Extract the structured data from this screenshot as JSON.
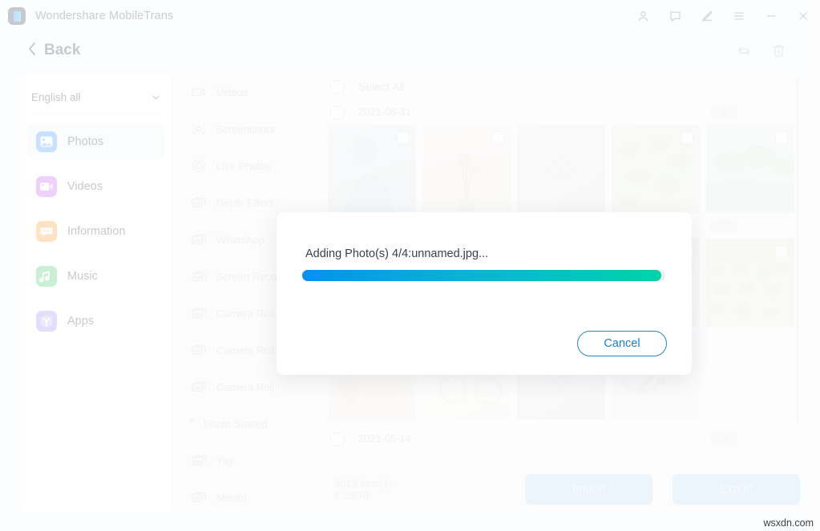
{
  "window": {
    "app_title": "Wondershare MobileTrans",
    "logo_colors": {
      "badge": "#2b2f4a",
      "gradient_from": "#1b8cff",
      "gradient_to": "#19d6b0"
    },
    "controls": [
      {
        "name": "account-icon",
        "label": "Account"
      },
      {
        "name": "feedback-icon",
        "label": "Feedback"
      },
      {
        "name": "edit-icon",
        "label": "Edit"
      },
      {
        "name": "menu-icon",
        "label": "Menu"
      },
      {
        "name": "minimize-icon",
        "label": "Minimize"
      },
      {
        "name": "close-icon",
        "label": "Close"
      }
    ]
  },
  "header": {
    "back_label": "Back",
    "tools": [
      {
        "name": "refresh-icon",
        "label": "Refresh"
      },
      {
        "name": "trash-icon",
        "label": "Delete"
      }
    ]
  },
  "sidebar": {
    "language_select": {
      "value": "English all",
      "chevron": "chevron-down-icon"
    },
    "items": [
      {
        "label": "Photos",
        "icon": "photos-icon",
        "color_from": "#2e8bff",
        "color_to": "#1f6ff0",
        "active": true
      },
      {
        "label": "Videos",
        "icon": "videos-icon",
        "color_from": "#c14bf0",
        "color_to": "#9b3ae8",
        "active": false
      },
      {
        "label": "Information",
        "icon": "information-icon",
        "color_from": "#f8a21c",
        "color_to": "#ef7d10",
        "active": false
      },
      {
        "label": "Music",
        "icon": "music-icon",
        "color_from": "#34c759",
        "color_to": "#1ea94a",
        "active": false
      },
      {
        "label": "Apps",
        "icon": "apps-icon",
        "color_from": "#9b82f5",
        "color_to": "#7b62ee",
        "active": false
      }
    ]
  },
  "categories": [
    {
      "label": "Videos",
      "icon": "video-camera-icon",
      "type": "item"
    },
    {
      "label": "Screenshots",
      "icon": "screenshot-icon",
      "type": "item"
    },
    {
      "label": "Live Photos",
      "icon": "live-photo-icon",
      "type": "item"
    },
    {
      "label": "Depth Effect",
      "icon": "album-icon",
      "type": "item"
    },
    {
      "label": "WhatsApp",
      "icon": "album-icon",
      "type": "item"
    },
    {
      "label": "Screen Recorder",
      "icon": "album-icon",
      "type": "item"
    },
    {
      "label": "Camera Roll",
      "icon": "album-icon",
      "type": "item"
    },
    {
      "label": "Camera Roll",
      "icon": "album-icon",
      "type": "item"
    },
    {
      "label": "Camera Roll",
      "icon": "album-icon",
      "type": "item"
    },
    {
      "label": "Photo Shared",
      "icon": "caret-down-icon",
      "type": "group"
    },
    {
      "label": "Yay",
      "icon": "album-icon",
      "type": "item"
    },
    {
      "label": "Meishi",
      "icon": "album-icon",
      "type": "item"
    }
  ],
  "content": {
    "select_all_label": "Select All",
    "groups": [
      {
        "date": "2021-08-31",
        "badge": "5",
        "rows": [
          [
            {
              "kind": "photo",
              "style": "ph-person",
              "checkbox": true
            },
            {
              "kind": "photo",
              "style": "ph-flowers",
              "checkbox": true
            },
            {
              "kind": "video",
              "style": "ph-video",
              "checkbox": false
            },
            {
              "kind": "photo",
              "style": "ph-leaves",
              "checkbox": true
            },
            {
              "kind": "photo",
              "style": "ph-palms",
              "checkbox": true
            }
          ]
        ]
      },
      {
        "date": "",
        "badge": "9",
        "rows": [
          [
            {
              "kind": "photo",
              "style": "ph-garden",
              "checkbox": true
            },
            {
              "kind": "photo",
              "style": "ph-garden",
              "checkbox": true
            },
            {
              "kind": "photo",
              "style": "ph-garden",
              "checkbox": true
            },
            {
              "kind": "photo",
              "style": "ph-garden",
              "checkbox": true
            },
            {
              "kind": "photo",
              "style": "ph-garden",
              "checkbox": true
            }
          ],
          [
            {
              "kind": "photo",
              "style": "ph-cake",
              "checkbox": false
            },
            {
              "kind": "photo",
              "style": "ph-chart",
              "checkbox": false
            },
            {
              "kind": "video",
              "style": "ph-room",
              "checkbox": false
            },
            {
              "kind": "photo",
              "style": "ph-desk",
              "checkbox": false
            }
          ]
        ]
      },
      {
        "date": "2021-05-14",
        "badge": "3",
        "rows": []
      }
    ]
  },
  "bottom": {
    "item_count": "3013 item(s), 2.03GB",
    "import_label": "Import",
    "export_label": "Export"
  },
  "modal": {
    "message": "Adding Photo(s) 4/4:unnamed.jpg...",
    "progress_percent": 99,
    "progress_gradient_from": "#0b8ff0",
    "progress_gradient_to": "#00d2a8",
    "cancel_label": "Cancel",
    "cancel_color": "#1a7fd0"
  },
  "watermark": "wsxdn.com"
}
